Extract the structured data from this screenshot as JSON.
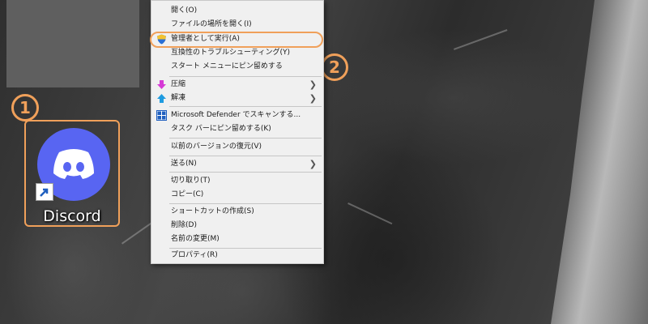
{
  "desktop": {
    "shortcut": {
      "label": "Discord"
    },
    "step_badges": [
      "1",
      "2"
    ]
  },
  "context_menu": {
    "items": [
      {
        "label": "開く(O)"
      },
      {
        "label": "ファイルの場所を開く(I)"
      },
      {
        "label": "管理者として実行(A)",
        "icon": "uac-shield-icon",
        "highlighted": true
      },
      {
        "label": "互換性のトラブルシューティング(Y)"
      },
      {
        "label": "スタート メニューにピン留めする"
      },
      {
        "label": "圧縮",
        "icon": "compress-arrow-icon",
        "submenu": true
      },
      {
        "label": "解凍",
        "icon": "extract-arrow-icon",
        "submenu": true
      },
      {
        "label": "Microsoft Defender でスキャンする...",
        "icon": "defender-icon"
      },
      {
        "label": "タスク バーにピン留めする(K)"
      },
      {
        "label": "以前のバージョンの復元(V)"
      },
      {
        "label": "送る(N)",
        "submenu": true
      },
      {
        "label": "切り取り(T)"
      },
      {
        "label": "コピー(C)"
      },
      {
        "label": "ショートカットの作成(S)"
      },
      {
        "label": "削除(D)"
      },
      {
        "label": "名前の変更(M)"
      },
      {
        "label": "プロパティ(R)"
      }
    ]
  },
  "colors": {
    "accent_outline": "#f0a05a",
    "discord_blurple": "#5865f2",
    "menu_background": "#f0f0f0"
  }
}
